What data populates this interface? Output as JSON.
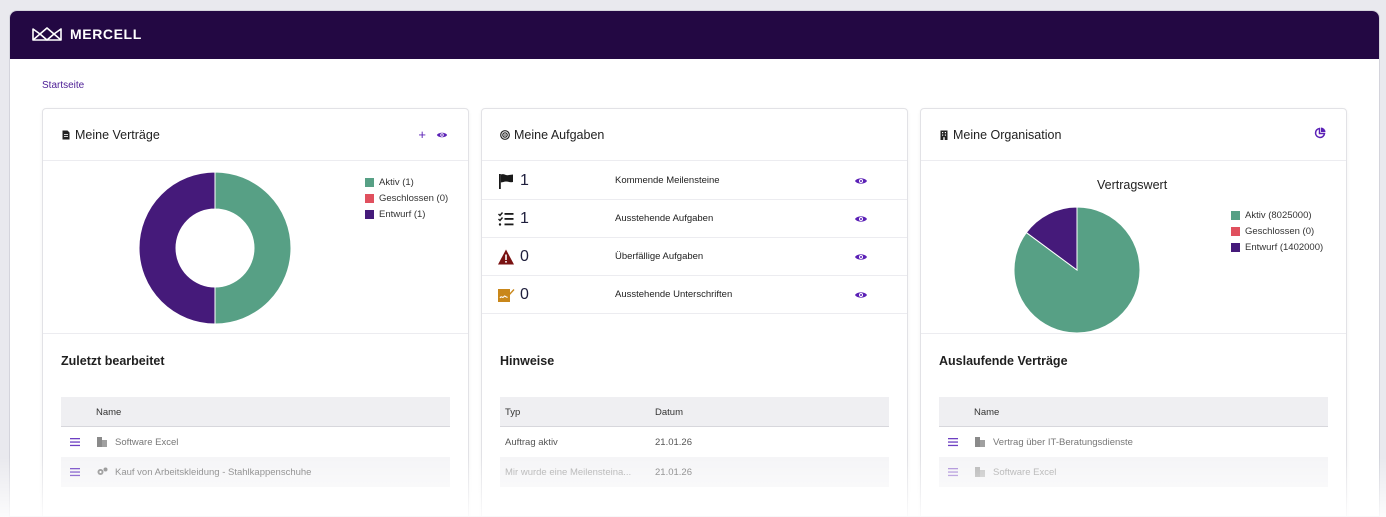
{
  "brand": {
    "name": "MERCELL"
  },
  "breadcrumb": {
    "home": "Startseite"
  },
  "contracts": {
    "title": "Meine Verträge",
    "actions": {
      "add": "+"
    },
    "legend": [
      "Aktiv (1)",
      "Geschlossen (0)",
      "Entwurf (1)"
    ],
    "recent_title": "Zuletzt bearbeitet",
    "table": {
      "col_name": "Name",
      "rows": [
        "Software Excel",
        "Kauf von Arbeitskleidung - Stahlkappenschuhe"
      ]
    }
  },
  "tasks": {
    "title": "Meine Aufgaben",
    "rows": [
      {
        "count": "1",
        "label": "Kommende Meilensteine"
      },
      {
        "count": "1",
        "label": "Ausstehende Aufgaben"
      },
      {
        "count": "0",
        "label": "Überfällige Aufgaben"
      },
      {
        "count": "0",
        "label": "Ausstehende Unterschriften"
      }
    ],
    "notes_title": "Hinweise",
    "table": {
      "col_type": "Typ",
      "col_date": "Datum",
      "rows": [
        {
          "type": "Auftrag aktiv",
          "date": "21.01.26"
        },
        {
          "type": "Mir wurde eine Meilensteina...",
          "date": "21.01.26"
        }
      ]
    }
  },
  "organisation": {
    "title": "Meine Organisation",
    "chart_title": "Vertragswert",
    "legend": [
      "Aktiv (8025000)",
      "Geschlossen (0)",
      "Entwurf (1402000)"
    ],
    "expiring_title": "Auslaufende Verträge",
    "table": {
      "col_name": "Name",
      "rows": [
        "Vertrag über IT-Beratungsdienste",
        "Software Excel"
      ]
    }
  },
  "colors": {
    "topbar": "#230843",
    "accent": "#5b21b6",
    "active": "#57a085",
    "closed": "#e0505e",
    "draft": "#451a7a"
  },
  "chart_data": [
    {
      "type": "pie",
      "donut": true,
      "categories": [
        "Aktiv",
        "Geschlossen",
        "Entwurf"
      ],
      "values": [
        1,
        0,
        1
      ],
      "title": "",
      "legend": "right"
    },
    {
      "type": "pie",
      "categories": [
        "Aktiv",
        "Geschlossen",
        "Entwurf"
      ],
      "values": [
        8025000,
        0,
        1402000
      ],
      "title": "Vertragswert",
      "legend": "right"
    }
  ]
}
